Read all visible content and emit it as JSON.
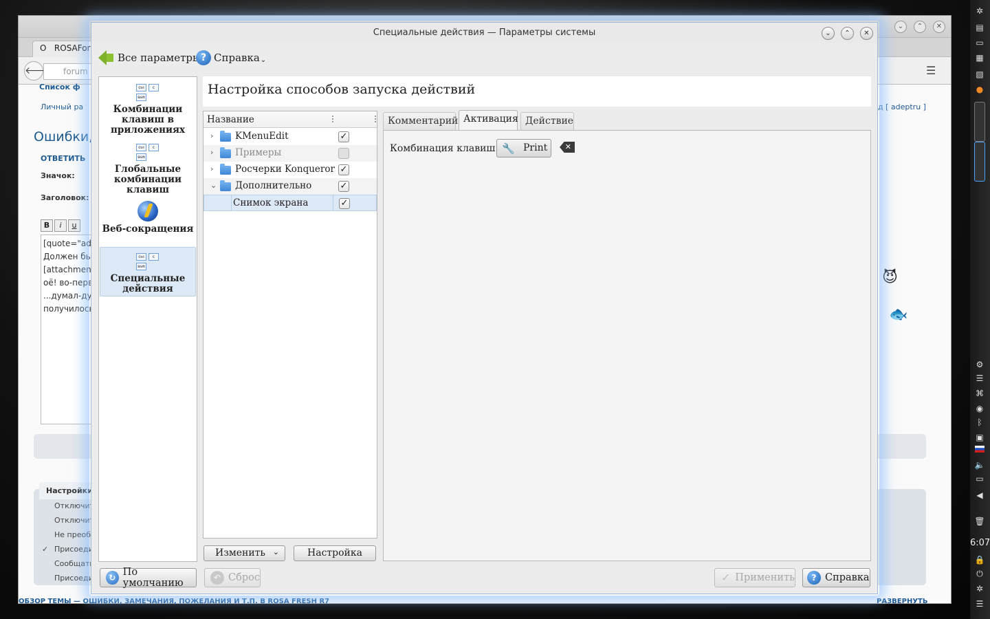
{
  "dialog": {
    "title": "Специальные действия  — Параметры системы",
    "toolbar": {
      "all_settings": "Все параметры",
      "help": "Справка",
      "help_caret": "⌄"
    },
    "categories": [
      {
        "label": "Комбинации клавиш в приложениях",
        "icon": "keyboard-shortcuts-icon"
      },
      {
        "label": "Глобальные комбинации клавиш",
        "icon": "keyboard-shortcuts-icon"
      },
      {
        "label": "Веб-сокращения",
        "icon": "web-globe-icon"
      },
      {
        "label": "Специальные действия",
        "icon": "keyboard-shortcuts-icon",
        "selected": true
      }
    ],
    "key_labels": {
      "ctrl": "Ctrl",
      "c": "C",
      "shift": "Shift"
    },
    "header_title": "Настройка способов запуска действий",
    "tree": {
      "column_name": "Название",
      "rows": [
        {
          "chevron": "›",
          "label": "KMenuEdit",
          "checked": "✓",
          "enabled": true
        },
        {
          "chevron": "›",
          "label": "Примеры",
          "checked": "",
          "enabled": false
        },
        {
          "chevron": "›",
          "label": "Росчерки Konqueror",
          "checked": "✓",
          "enabled": true
        },
        {
          "chevron": "⌄",
          "label": "Дополнительно",
          "checked": "✓",
          "enabled": true
        },
        {
          "chevron": "",
          "label": "Снимок экрана",
          "checked": "✓",
          "enabled": true,
          "selected": true
        }
      ]
    },
    "edit_button": "Изменить",
    "edit_caret": "⌄",
    "settings_button": "Настройка",
    "tabs": [
      "Комментарий",
      "Активация",
      "Действие"
    ],
    "active_tab": "Активация",
    "activation": {
      "shortcut_label": "Комбинация клавиш:",
      "shortcut_value": "Print",
      "clear_icon_glyph": "✕"
    },
    "bottom": {
      "defaults": "По умолчанию",
      "reset": "Сброс",
      "apply": "Применить",
      "help": "Справка"
    },
    "window_buttons": {
      "minimize": "⌄",
      "maximize": "⌃",
      "close": "✕"
    }
  },
  "background_browser": {
    "tab_title": "ROSAForum",
    "tab_letter": "O",
    "url_fragment": "forum",
    "links": {
      "forum_list": "Список ф",
      "private": "Личный ра",
      "user": "д [ adeptru ]"
    },
    "page_heading": "Ошибки,",
    "reply": "ОТВЕТИТЬ",
    "icon_label": "Значок:",
    "subject_label": "Заголовок:",
    "editor_lines": [
      "[quote=\"ade",
      "Должен бы",
      "[attachment",
      "оё! во-перв",
      "...думал-ду",
      "получилось"
    ],
    "format_buttons": [
      "B",
      "i",
      "u"
    ],
    "settings_tab": "Настройки",
    "options": [
      "Отключит",
      "Отключит",
      "Не преобр",
      "Присоеди",
      "Сообщать",
      "Присоеди"
    ],
    "option_check": "✓",
    "bottom_text": "ОБЗОР ТЕМЫ — ОШИБКИ, ЗАМЕЧАНИЯ, ПОЖЕЛАНИЯ И Т.П. В ROSA FRESH R7",
    "bottom_right": "РАЗВЕРНУТЬ"
  },
  "panel": {
    "clock": "6:07"
  }
}
